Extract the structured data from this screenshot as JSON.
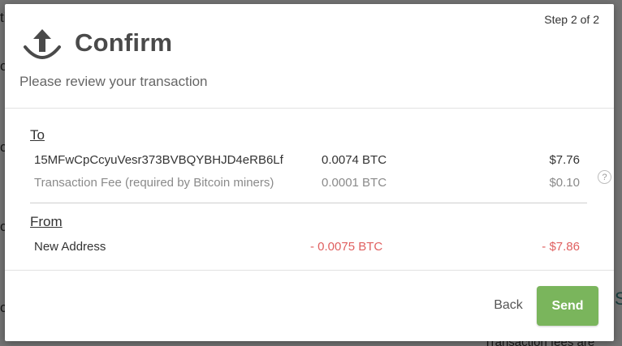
{
  "modal": {
    "step_text": "Step 2 of 2",
    "title": "Confirm",
    "subtitle": "Please review your transaction",
    "to_label": "To",
    "to_rows": [
      {
        "label": "15MFwCpCcyuVesr373BVBQYBHJD4eRB6Lf",
        "btc": "0.0074 BTC",
        "usd": "$7.76"
      },
      {
        "label": "Transaction Fee (required by Bitcoin miners)",
        "btc": "0.0001 BTC",
        "usd": "$0.10"
      }
    ],
    "help_glyph": "?",
    "from_label": "From",
    "from_rows": [
      {
        "label": "New Address",
        "btc": "- 0.0075 BTC",
        "usd": "- $7.86"
      }
    ],
    "back_label": "Back",
    "send_label": "Send"
  },
  "colors": {
    "send_button": "#7ab55c",
    "negative_amount": "#e06060",
    "title": "#4a4a4a"
  },
  "icons": {
    "header": "send-upload-icon",
    "help": "help-circle-icon"
  }
}
